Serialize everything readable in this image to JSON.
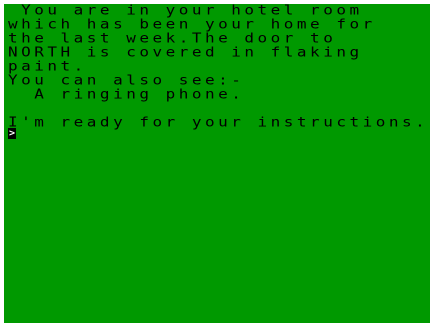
{
  "game": {
    "description_lines": [
      " You are in your hotel room",
      "which has been your home for",
      "the last week.The door to",
      "NORTH is covered in flaking",
      "paint."
    ],
    "see_header": "You can also see:-",
    "items": [
      "  A ringing phone."
    ],
    "ready_message": "I'm ready for your instructions.",
    "cursor_symbol": ">"
  },
  "colors": {
    "screen_background": "#009900",
    "border": "#ffffff",
    "text": "#000000"
  }
}
